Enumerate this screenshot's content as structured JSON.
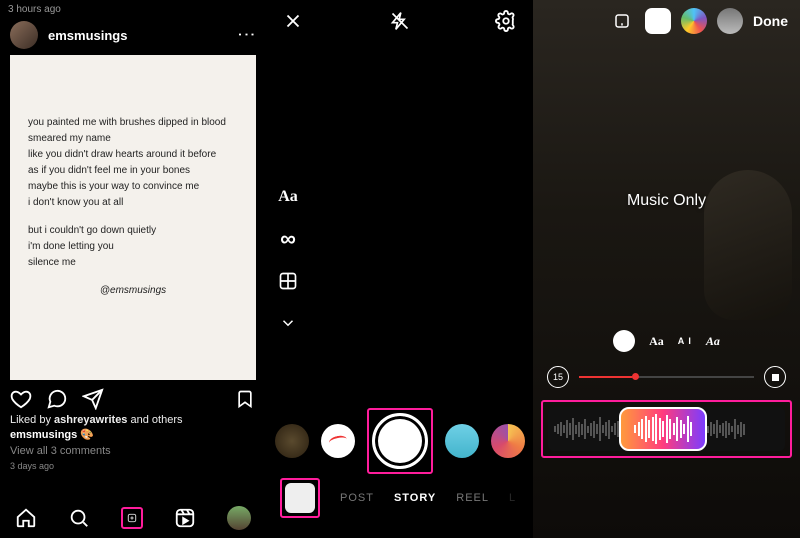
{
  "panel1": {
    "timestamp_top": "3 hours ago",
    "username": "emsmusings",
    "poem1": "you painted me with brushes dipped in blood\nsmeared my name\nlike you didn't draw hearts around it before\nas if you didn't feel me in your bones\nmaybe this is your way to convince me\ni don't know you at all",
    "poem2": "but i couldn't go down quietly\ni'm done letting you\nsilence me",
    "signature": "@emsmusings",
    "liked_by_user": "ashreyawrites",
    "liked_by_suffix": "and others",
    "caption_user": "emsmusings",
    "caption_emoji": "🎨",
    "view_comments": "View all 3 comments",
    "age": "3 days ago",
    "liked_prefix": "Liked by"
  },
  "panel2": {
    "side": {
      "text": "Aa",
      "infinity": "∞"
    },
    "modes": {
      "post": "POST",
      "story": "STORY",
      "reel": "REEL",
      "live": "L"
    }
  },
  "panel3": {
    "done": "Done",
    "music_label": "Music Only",
    "duration": "15",
    "styles": {
      "no": "⊘",
      "aa": "Aa",
      "ai": "A I",
      "aa2": "Aa"
    }
  }
}
